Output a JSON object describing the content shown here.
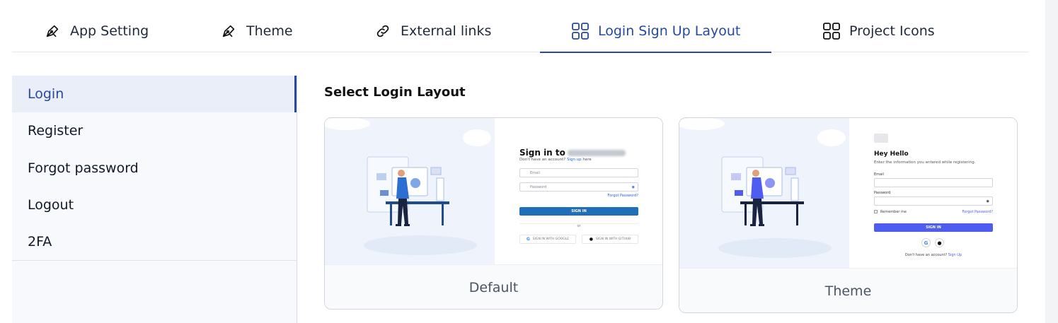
{
  "tabs": [
    {
      "label": "App Setting",
      "icon": "pen-icon"
    },
    {
      "label": "Theme",
      "icon": "pen-icon"
    },
    {
      "label": "External links",
      "icon": "link-icon"
    },
    {
      "label": "Login Sign Up Layout",
      "icon": "grid-icon",
      "active": true
    },
    {
      "label": "Project Icons",
      "icon": "grid-icon"
    }
  ],
  "sidebar": {
    "items": [
      {
        "label": "Login",
        "active": true
      },
      {
        "label": "Register"
      },
      {
        "label": "Forgot password"
      },
      {
        "label": "Logout"
      },
      {
        "label": "2FA"
      }
    ]
  },
  "main": {
    "title": "Select Login Layout",
    "cards": [
      {
        "caption": "Default",
        "preview": {
          "title_prefix": "Sign in to",
          "subtitle": "Don't have an account?",
          "signup_link": "Sign up",
          "subtitle_suffix": "here",
          "email_placeholder": "Email",
          "password_placeholder": "Password",
          "forgot": "Forgot Password?",
          "button": "SIGN IN",
          "or": "or",
          "google": "SIGN IN WITH GOOGLE",
          "github": "SIGN IN WITH GITHUB",
          "button_color": "#1f6fb8"
        }
      },
      {
        "caption": "Theme",
        "preview": {
          "title": "Hey Hello",
          "subtitle": "Enter the information you entered while registering.",
          "email_label": "Email",
          "password_label": "Password",
          "remember": "Remember me",
          "forgot": "Forgot Password?",
          "button": "SIGN IN",
          "no_account": "Don't have an account?",
          "signup_link": "Sign Up",
          "button_color": "#4f5cf0"
        }
      }
    ]
  },
  "colors": {
    "accent": "#274a9c",
    "sidebar_bg": "#f7f9fc",
    "active_bg": "#e9eef8"
  }
}
